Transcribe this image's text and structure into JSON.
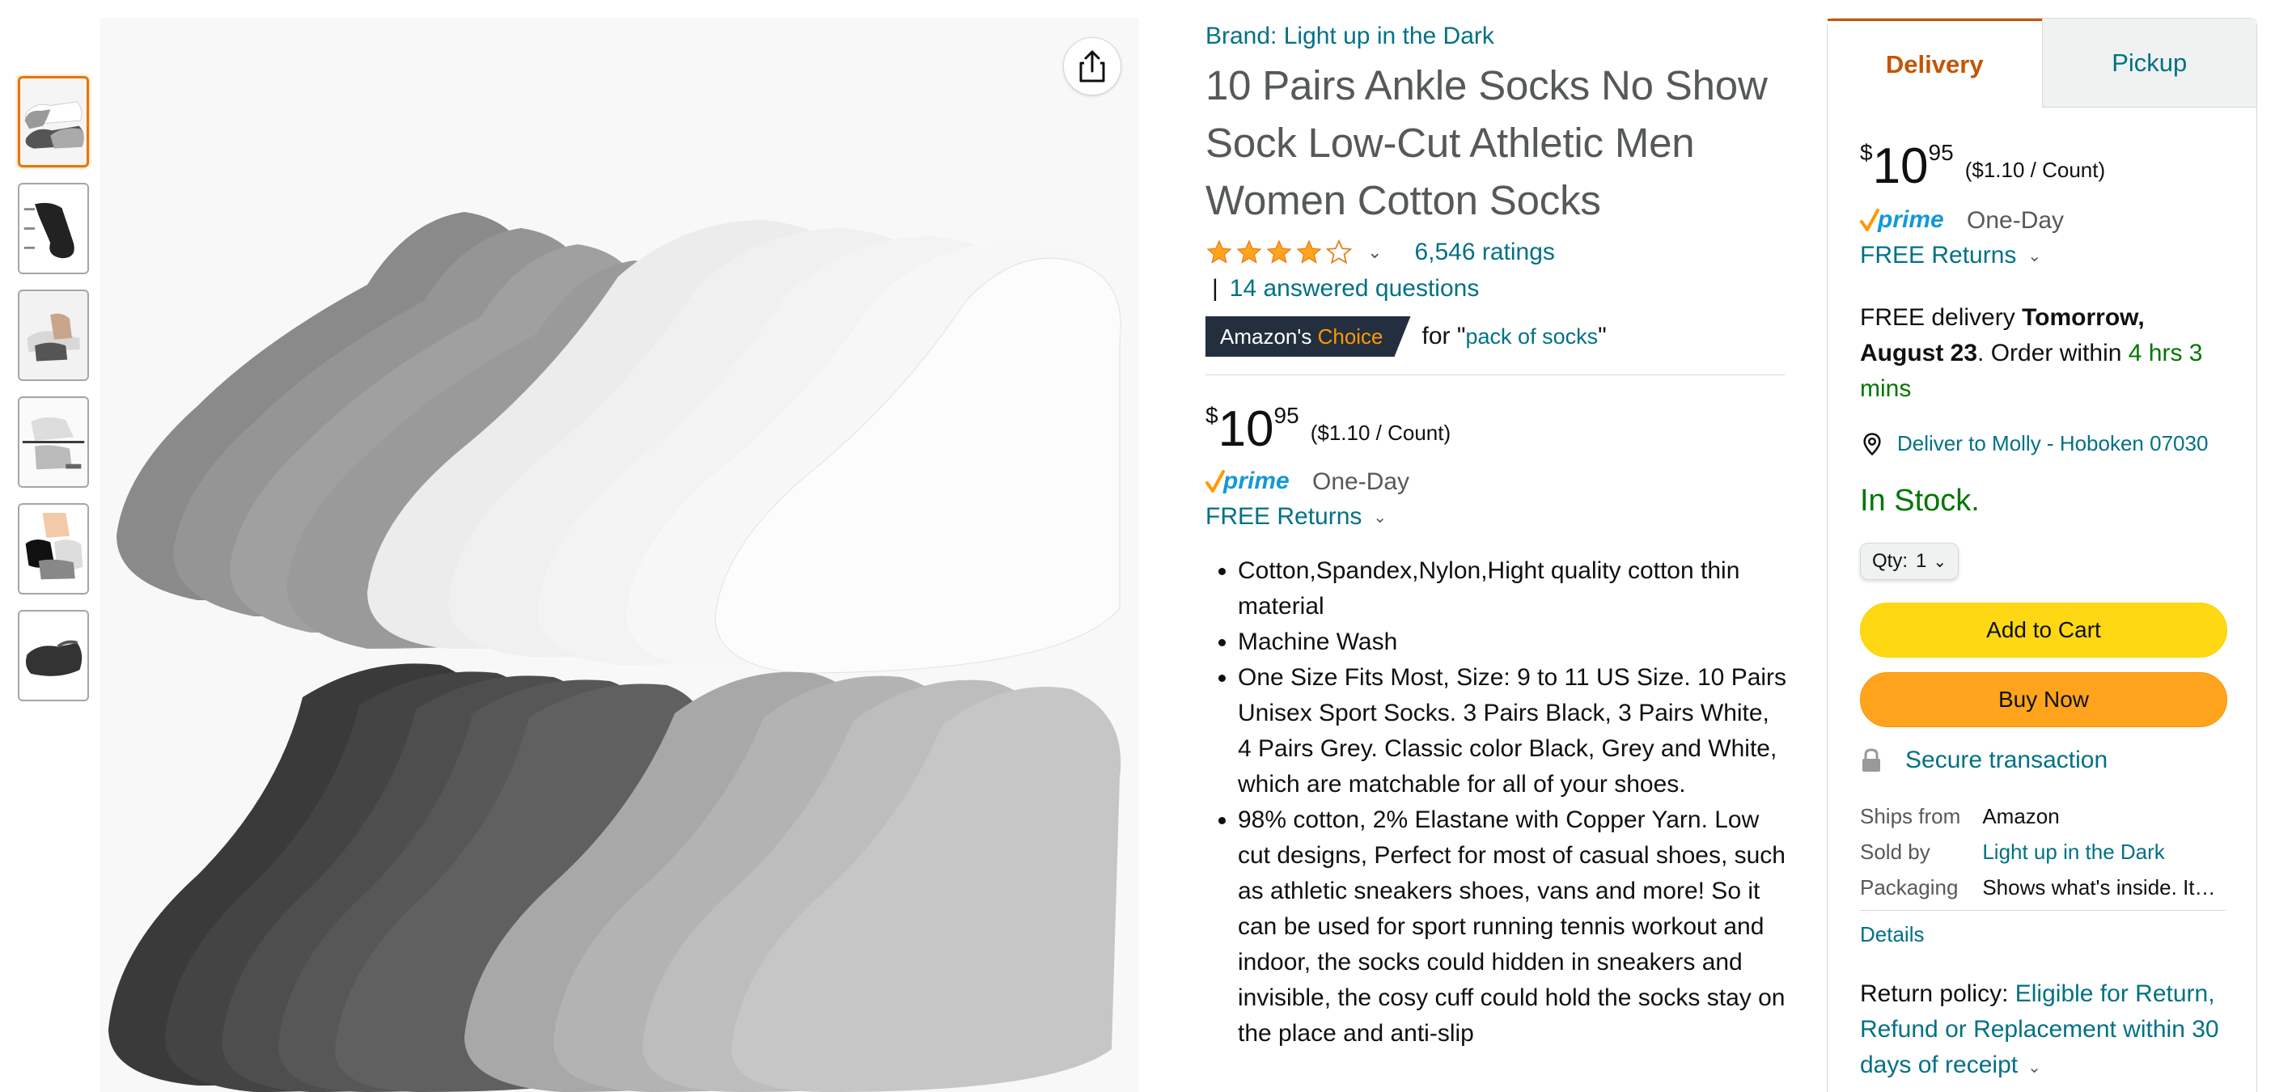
{
  "thumbnails": [
    {
      "label": "thumbnail-1"
    },
    {
      "label": "thumbnail-2"
    },
    {
      "label": "thumbnail-3"
    },
    {
      "label": "thumbnail-4"
    },
    {
      "label": "thumbnail-5"
    },
    {
      "label": "thumbnail-6"
    }
  ],
  "product": {
    "brand": "Brand: Light up in the Dark",
    "title": "10 Pairs Ankle Socks No Show Sock Low-Cut Athletic Men Women Cotton Socks",
    "rating": 4.5,
    "ratings_count": "6,546 ratings",
    "qa_pipe": "|",
    "questions": "14 answered questions",
    "choice_prefix": "Amazon's",
    "choice_word": "Choice",
    "choice_for": "for \"",
    "choice_keyword": "pack of socks",
    "choice_close": "\"",
    "price_symbol": "$",
    "price_whole": "10",
    "price_fraction": "95",
    "price_unit": "($1.10 / Count)",
    "prime_label": "prime",
    "prime_speed": "One-Day",
    "returns": "FREE Returns",
    "bullets": [
      "Cotton,Spandex,Nylon,Hight quality cotton thin material",
      "Machine Wash",
      "One Size Fits Most, Size: 9 to 11 US Size. 10 Pairs Unisex Sport Socks. 3 Pairs Black, 3 Pairs White, 4 Pairs Grey. Classic color Black, Grey and White, which are matchable for all of your shoes.",
      "98% cotton, 2% Elastane with Copper Yarn. Low cut designs, Perfect for most of casual shoes, such as athletic sneakers shoes, vans and more! So it can be used for sport running tennis workout and indoor, the socks could hidden in sneakers and invisible, the cosy cuff could hold the socks stay on the place and anti-slip"
    ]
  },
  "buybox": {
    "tab_delivery": "Delivery",
    "tab_pickup": "Pickup",
    "price_symbol": "$",
    "price_whole": "10",
    "price_fraction": "95",
    "price_unit": "($1.10 / Count)",
    "prime_label": "prime",
    "prime_speed": "One-Day",
    "returns": "FREE Returns",
    "delivery_prefix": "FREE delivery ",
    "delivery_date": "Tomorrow, August 23",
    "delivery_mid": ". Order within ",
    "delivery_window": "4 hrs 3 mins",
    "deliver_to": "Deliver to Molly - Hoboken 07030",
    "stock": "In Stock.",
    "qty_label": "Qty:",
    "qty_value": "1",
    "add_to_cart": "Add to Cart",
    "buy_now": "Buy Now",
    "secure": "Secure transaction",
    "ships_from_label": "Ships from",
    "ships_from_value": "Amazon",
    "sold_by_label": "Sold by",
    "sold_by_value": "Light up in the Dark",
    "packaging_label": "Packaging",
    "packaging_value": "Shows what's inside. It…",
    "details": "Details",
    "return_policy_label": "Return policy: ",
    "return_policy_value": "Eligible for Return, Refund or Replacement within 30 days of receipt"
  },
  "colors": {
    "link": "#007185",
    "orange_active": "#c45500",
    "in_stock": "#007600",
    "cart_button": "#ffd814",
    "buy_button": "#ffa41c",
    "badge_bg": "#232f3e",
    "star": "#ffa41c"
  }
}
